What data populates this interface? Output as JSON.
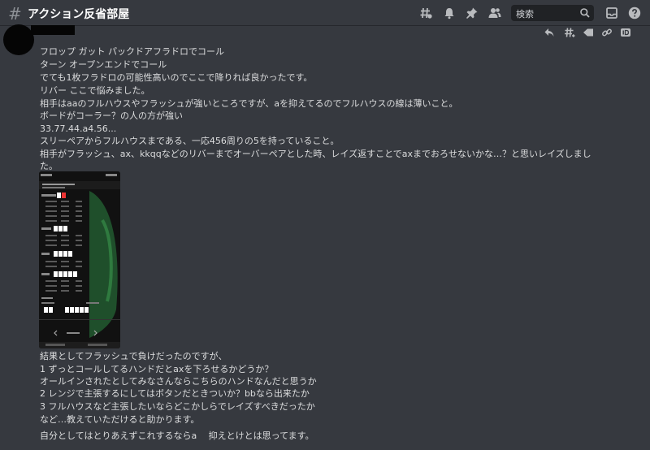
{
  "header": {
    "hash_glyph": "#",
    "channel_name": "アクション反省部屋",
    "search_placeholder": "検索"
  },
  "message": {
    "lines_top": [
      "フロップ ガット パックドアフラドロでコール",
      "ターン オープンエンドでコール",
      "でても1枚フラドロの可能性高いのでここで降りれば良かったです。",
      "リバー ここで悩みました。",
      "相手はaaのフルハウスやフラッシュが強いところですが、aを抑えてるのでフルハウスの線は薄いこと。",
      "ボードがコーラー？の人の方が強い",
      "33.77.44.a4.56...",
      "スリーペアからフルハウスまである、一応456周りの5を持っていること。",
      "相手がフラッシュ、ax、kkqqなどのリバーまでオーバーペアとした時、レイズ返すことでaxまでおろせないかな…？と思いレイズしまし",
      "た。"
    ],
    "lines_bottom": [
      "結果としてフラッシュで負けだったのですが、",
      "1 ずっとコールしてるハンドだとaxを下ろせるかどうか？",
      "オールインされたとしてみなさんならこちらのハンドなんだと思うか",
      "2 レンジで主張するにしてはボタンだときついか？bbなら出来たか",
      "3 フルハウスなど主張したいならどこかしらでレイズすべきだったか",
      "など…教えていただけると助かります。",
      "自分としてはとりあえずこれするならa　 抑えとけとは思ってます。"
    ]
  }
}
